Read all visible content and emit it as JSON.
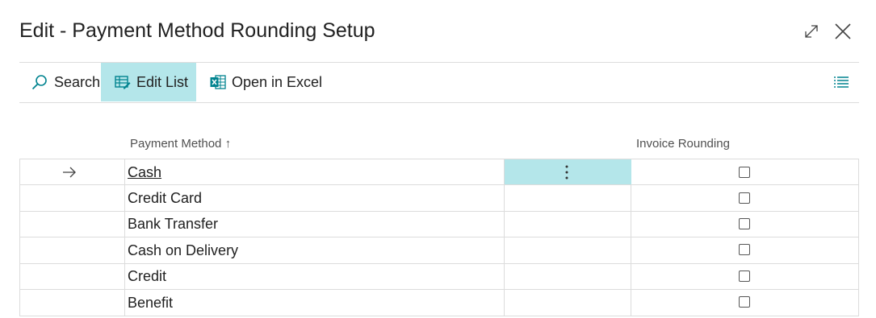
{
  "page": {
    "title": "Edit - Payment Method Rounding Setup"
  },
  "toolbar": {
    "search_label": "Search",
    "edit_list_label": "Edit List",
    "open_in_excel_label": "Open in Excel"
  },
  "columns": {
    "payment_method": "Payment Method",
    "sort_indicator": "↑",
    "invoice_rounding": "Invoice Rounding"
  },
  "rows": [
    {
      "payment_method": "Cash",
      "invoice_rounding": false,
      "selected": true
    },
    {
      "payment_method": "Credit Card",
      "invoice_rounding": false
    },
    {
      "payment_method": "Bank Transfer",
      "invoice_rounding": false
    },
    {
      "payment_method": "Cash on Delivery",
      "invoice_rounding": false
    },
    {
      "payment_method": "Credit",
      "invoice_rounding": false
    },
    {
      "payment_method": "Benefit",
      "invoice_rounding": false
    }
  ],
  "icons": {
    "expand": "expand-icon",
    "close": "close-icon",
    "search": "search-icon",
    "edit_list": "edit-list-icon",
    "excel": "excel-icon",
    "list_view": "list-view-icon",
    "row_arrow": "arrow-right-icon",
    "row_menu": "more-vertical-icon"
  },
  "colors": {
    "accent_highlight": "#b4e6ea",
    "icon_teal": "#00838f",
    "border": "#dcdcdc"
  }
}
